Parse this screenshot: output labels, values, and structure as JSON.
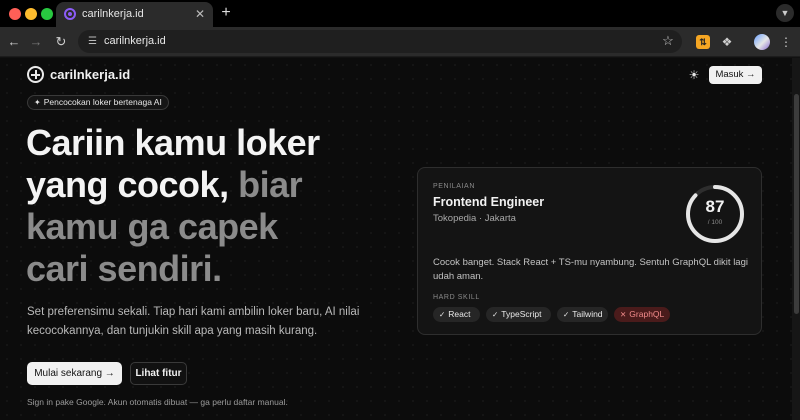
{
  "browser": {
    "tab_title": "carilnkerja.id",
    "tab_close": "✕",
    "new_tab": "+",
    "url": "carilnkerja.id",
    "icons": {
      "back": "arrow-left-icon",
      "forward": "arrow-right-icon",
      "reload": "reload-icon",
      "site_info": "tune-icon",
      "bookmark": "star-icon",
      "extension": "extension-icon",
      "puzzle": "puzzle-icon",
      "profile": "avatar",
      "menu": "kebab-icon"
    }
  },
  "header": {
    "brand": "carilnkerja.id",
    "login": "Masuk →"
  },
  "hero": {
    "badge": "Pencocokan loker bertenaga AI",
    "title_bright_1": "Cariin kamu loker",
    "title_bright_2": "yang cocok,",
    "title_dim_1": " biar",
    "title_dim_2": "kamu ga capek",
    "title_dim_3": "cari sendiri.",
    "description": "Set preferensimu sekali. Tiap hari kami ambilin loker baru, AI nilai kecocokannya, dan tunjukin skill apa yang masih kurang.",
    "cta_primary": "Mulai sekarang →",
    "cta_secondary": "Lihat fitur",
    "note": "Sign in pake Google. Akun otomatis dibuat — ga perlu daftar manual."
  },
  "card": {
    "label": "PENILAIAN",
    "title": "Frontend Engineer",
    "subtitle": "Tokopedia · Jakarta",
    "score": "87",
    "score_max": "/ 100",
    "score_fraction": 0.87,
    "description": "Cocok banget. Stack React + TS-mu nyambung. Sentuh GraphQL dikit lagi udah aman.",
    "skills_label": "HARD SKILL",
    "skills": [
      {
        "name": "React",
        "mark": "✓",
        "matched": true
      },
      {
        "name": "TypeScript",
        "mark": "✓",
        "matched": true
      },
      {
        "name": "Tailwind",
        "mark": "✓",
        "matched": true
      },
      {
        "name": "GraphQL",
        "mark": "✕",
        "matched": false
      }
    ]
  },
  "colors": {
    "accent_missing_bg": "#4a1b1b",
    "accent_missing_text": "#f28b8b",
    "ring": "#e6e6e6",
    "ring_track": "#2e2e2e"
  }
}
